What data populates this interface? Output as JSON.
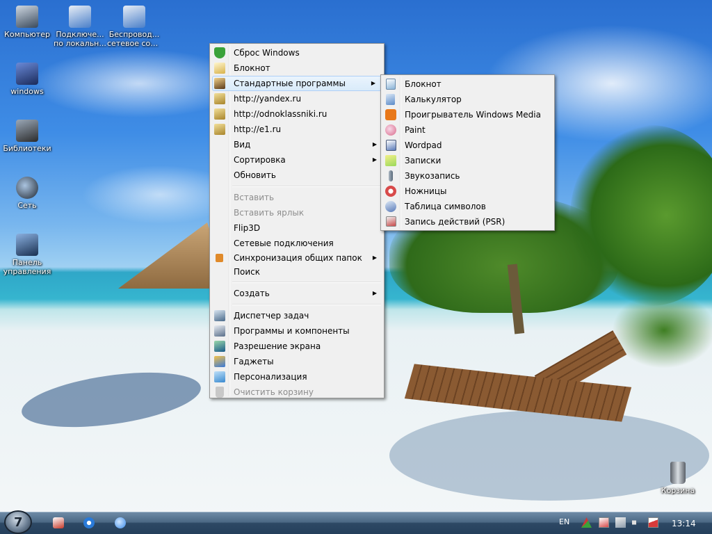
{
  "desktop": {
    "icons": [
      {
        "label": "Компьютер",
        "icon": "computer-icon",
        "color": "#3a4a5c"
      },
      {
        "label": "Подключе... по локальн...",
        "line1": "Подключе...",
        "line2": "по локальн...",
        "icon": "network-connection-icon",
        "color": "#4a7fc9"
      },
      {
        "label": "Беспровод... сетевое сое...",
        "line1": "Беспровод...",
        "line2": "сетевое сое...",
        "icon": "wireless-connection-icon",
        "color": "#4a7fc9"
      },
      {
        "label": "windows",
        "icon": "windows-folder-icon",
        "color": "#2a3c6a"
      },
      {
        "label": "Библиотеки",
        "icon": "libraries-icon",
        "color": "#3b3b3b"
      },
      {
        "label": "Сеть",
        "icon": "network-globe-icon",
        "color": "#2b3340"
      },
      {
        "label": "Панель управления",
        "line1": "Панель",
        "line2": "управления",
        "icon": "control-panel-icon",
        "color": "#2a4c7a"
      },
      {
        "label": "Корзина",
        "icon": "recycle-bin-icon",
        "color": "#7a8088"
      }
    ]
  },
  "context_menu": {
    "items_top": [
      {
        "label": "Сброс Windows",
        "icon": "shield-check-icon",
        "color": "#3aa23a"
      },
      {
        "label": "Блокнот",
        "icon": "notepad-icon",
        "color": "#d8b24a"
      },
      {
        "label": "Стандартные программы",
        "icon": "standard-programs-icon",
        "color": "#c6862a",
        "submenu": true
      },
      {
        "label": "http://yandex.ru",
        "icon": "link-icon",
        "color": "#c9a23a"
      },
      {
        "label": "http://odnoklassniki.ru",
        "icon": "link-icon",
        "color": "#c9a23a"
      },
      {
        "label": "http://e1.ru",
        "icon": "link-icon",
        "color": "#c9a23a"
      },
      {
        "label": "Вид",
        "submenu": true
      },
      {
        "label": "Сортировка",
        "submenu": true
      },
      {
        "label": "Обновить"
      }
    ],
    "items_mid": [
      {
        "label": "Вставить",
        "disabled": true
      },
      {
        "label": "Вставить ярлык",
        "disabled": true
      },
      {
        "label": "Flip3D"
      },
      {
        "label": "Сетевые подключения"
      },
      {
        "label": "Синхронизация общих папок",
        "icon": "sync-icon",
        "color": "#e08a2a",
        "submenu": true
      },
      {
        "label": "Поиск"
      }
    ],
    "items_create": [
      {
        "label": "Создать",
        "submenu": true
      }
    ],
    "items_bottom": [
      {
        "label": "Диспетчер задач",
        "icon": "task-manager-icon",
        "color": "#4a6a8a"
      },
      {
        "label": "Программы и компоненты",
        "icon": "programs-icon",
        "color": "#5a6f8a"
      },
      {
        "label": "Разрешение экрана",
        "icon": "display-icon",
        "color": "#2a8a4a"
      },
      {
        "label": "Гаджеты",
        "icon": "gadgets-icon",
        "color": "#3a7ad8"
      },
      {
        "label": "Персонализация",
        "icon": "personalization-icon",
        "color": "#3a8ad0"
      },
      {
        "label": "Очистить корзину",
        "icon": "empty-bin-icon",
        "color": "#b8b8b8",
        "disabled": true
      }
    ]
  },
  "submenu_standard": {
    "items": [
      {
        "label": "Блокнот",
        "icon": "notepad-icon",
        "color": "#8ab4d8"
      },
      {
        "label": "Калькулятор",
        "icon": "calculator-icon",
        "color": "#5a8ac8"
      },
      {
        "label": "Проигрыватель Windows Media",
        "icon": "media-player-icon",
        "color": "#e8781a"
      },
      {
        "label": "Paint",
        "icon": "paint-icon",
        "color": "#d86a8a"
      },
      {
        "label": "Wordpad",
        "icon": "wordpad-icon",
        "color": "#5a7ab8"
      },
      {
        "label": "Записки",
        "icon": "sticky-notes-icon",
        "color": "#9ad85a"
      },
      {
        "label": "Звукозапись",
        "icon": "microphone-icon",
        "color": "#5a6a7a"
      },
      {
        "label": "Ножницы",
        "icon": "scissors-icon",
        "color": "#d84a4a"
      },
      {
        "label": "Таблица символов",
        "icon": "char-map-icon",
        "color": "#5a7ab8"
      },
      {
        "label": "Запись действий (PSR)",
        "icon": "psr-icon",
        "color": "#c84a4a"
      }
    ]
  },
  "taskbar": {
    "start_glyph": "7",
    "quick_launch": [
      {
        "icon": "acrobat-icon",
        "color": "#c83a2a"
      },
      {
        "icon": "refresh-app-icon",
        "color": "#2a7ad8"
      },
      {
        "icon": "globe-app-icon",
        "color": "#3a8ae8"
      }
    ],
    "language": "EN",
    "tray_icons": [
      {
        "icon": "tray-arrow-icon",
        "color": "#c83a3a"
      },
      {
        "icon": "tray-flag-icon",
        "color": "#d84a4a"
      },
      {
        "icon": "tray-network-icon",
        "color": "#d8d8d8"
      },
      {
        "icon": "volume-icon",
        "color": "#e0e0e0"
      },
      {
        "icon": "action-center-icon",
        "color": "#d83a3a"
      }
    ],
    "clock": "13:14"
  }
}
